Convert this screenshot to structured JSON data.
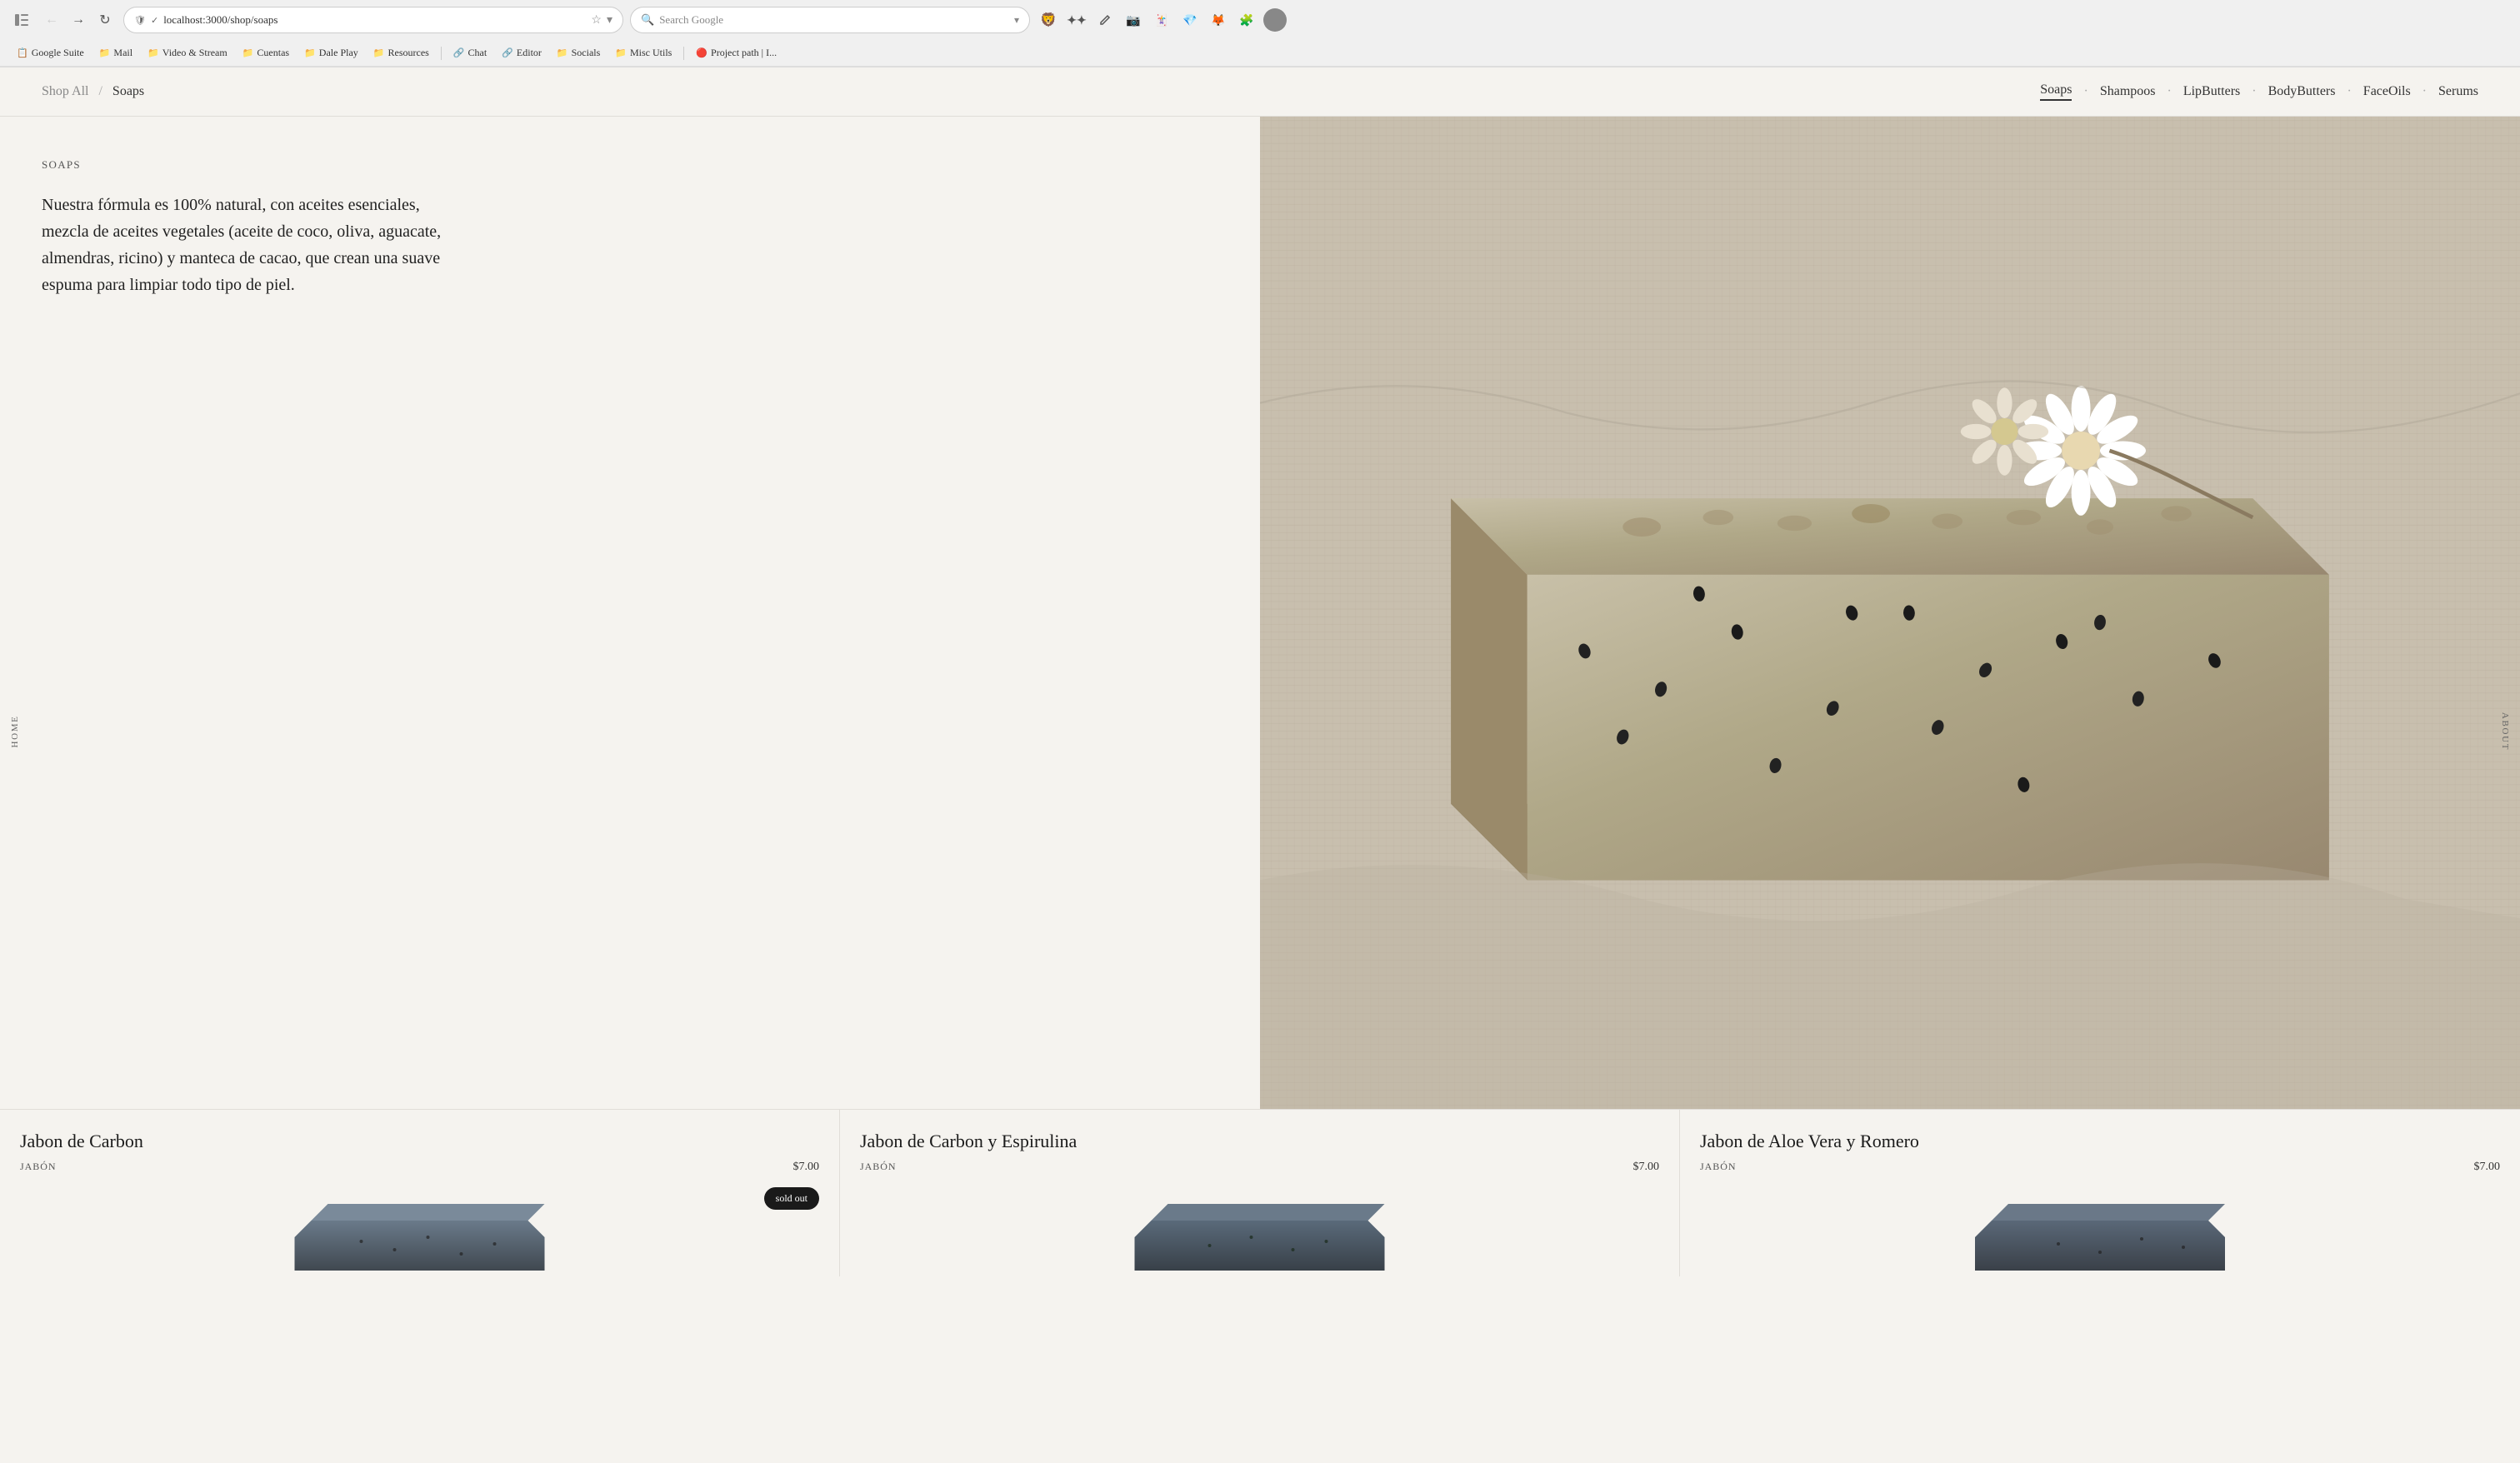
{
  "browser": {
    "back_button": "←",
    "forward_button": "→",
    "refresh_button": "↻",
    "url": "localhost:3000/shop/soaps",
    "search_placeholder": "Search Google",
    "bookmarks": [
      {
        "label": "Google Suite",
        "icon": "📋"
      },
      {
        "label": "Mail",
        "icon": "📁"
      },
      {
        "label": "Video & Stream",
        "icon": "📁"
      },
      {
        "label": "Cuentas",
        "icon": "📁"
      },
      {
        "label": "Dale Play",
        "icon": "📁"
      },
      {
        "label": "Resources",
        "icon": "📁"
      },
      {
        "label": "Chat",
        "icon": "🔗"
      },
      {
        "label": "Editor",
        "icon": "🔗"
      },
      {
        "label": "Socials",
        "icon": "📁"
      },
      {
        "label": "Misc Utils",
        "icon": "📁"
      },
      {
        "label": "Project path | I...",
        "icon": "🔴"
      }
    ]
  },
  "nav": {
    "breadcrumb_home": "Shop All",
    "breadcrumb_sep": "/",
    "breadcrumb_current": "Soaps",
    "menu_items": [
      {
        "label": "Soaps",
        "active": true
      },
      {
        "label": "Shampoos",
        "active": false
      },
      {
        "label": "LipButters",
        "active": false
      },
      {
        "label": "BodyButters",
        "active": false
      },
      {
        "label": "FaceOils",
        "active": false
      },
      {
        "label": "Serums",
        "active": false
      }
    ],
    "side_label_left": "HOME",
    "side_label_right": "ABOUT"
  },
  "hero": {
    "category": "SOAPS",
    "description": "Nuestra fórmula es 100% natural, con aceites esenciales, mezcla de aceites vegetales (aceite de coco, oliva, aguacate, almendras, ricino) y manteca de cacao, que crean una suave espuma para limpiar todo tipo de piel."
  },
  "products": [
    {
      "name": "Jabon de Carbon",
      "type": "JABÓN",
      "price": "$7.00",
      "sold_out": true,
      "sold_out_label": "sold out"
    },
    {
      "name": "Jabon de Carbon y Espirulina",
      "type": "JABÓN",
      "price": "$7.00",
      "sold_out": false,
      "sold_out_label": ""
    },
    {
      "name": "Jabon de Aloe Vera y Romero",
      "type": "JABÓN",
      "price": "$7.00",
      "sold_out": false,
      "sold_out_label": ""
    }
  ]
}
